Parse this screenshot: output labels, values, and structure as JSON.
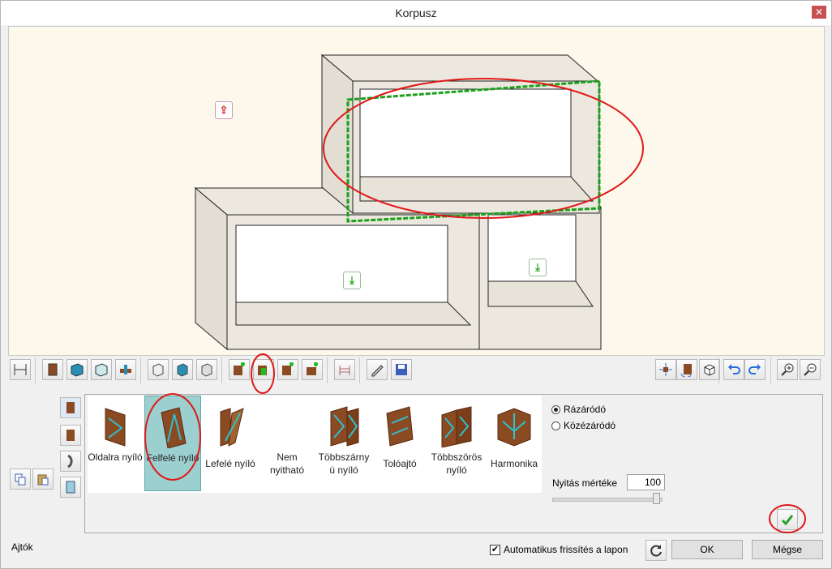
{
  "window": {
    "title": "Korpusz",
    "close_glyph": "✕"
  },
  "colors": {
    "wood": "#8a4a22",
    "cabinet_fill": "#ece8df",
    "selection_green": "#1aa01a",
    "annotation_red": "#e01818",
    "selected_type_bg": "#9ccfd0"
  },
  "viewport": {
    "icons": [
      "export-up-icon",
      "import-down-icon",
      "import-down-icon"
    ]
  },
  "toolbar": {
    "icons": [
      "dimension-icon",
      "panel-icon",
      "box-blue-icon",
      "box-outline-icon",
      "connector-icon",
      "frame-icon-1",
      "frame-icon-2",
      "frame-icon-3",
      "add-door-side-icon",
      "add-door-up-icon",
      "add-door-down-icon",
      "add-drawer-icon",
      "hinge-icon",
      "pencil-icon",
      "save-icon",
      "move-icon",
      "rotate-view-icon",
      "cube-icon",
      "undo-icon",
      "redo-icon",
      "zoom-in-icon",
      "zoom-out-icon"
    ]
  },
  "door_types": [
    {
      "label": "Oldalra nyíló",
      "selected": false
    },
    {
      "label": "Felfelé nyíló",
      "selected": true
    },
    {
      "label": "Lefelé nyíló",
      "selected": false
    },
    {
      "label": "Nem nyitható",
      "selected": false
    },
    {
      "label": "Többszárny ú nyíló",
      "selected": false
    },
    {
      "label": "Tolóajtó",
      "selected": false
    },
    {
      "label": "Többszörös nyíló",
      "selected": false
    },
    {
      "label": "Harmonika",
      "selected": false
    }
  ],
  "options": {
    "closing": [
      {
        "label": "Rázáródó",
        "checked": true
      },
      {
        "label": "Közézáródó",
        "checked": false
      }
    ],
    "opening_label": "Nyitás mértéke",
    "opening_value": "100",
    "opening_fraction": 1.0
  },
  "footer": {
    "status": "Ajtók",
    "auto_refresh_label": "Automatikus frissítés a lapon",
    "auto_refresh_checked": true,
    "ok_label": "OK",
    "cancel_label": "Mégse"
  }
}
